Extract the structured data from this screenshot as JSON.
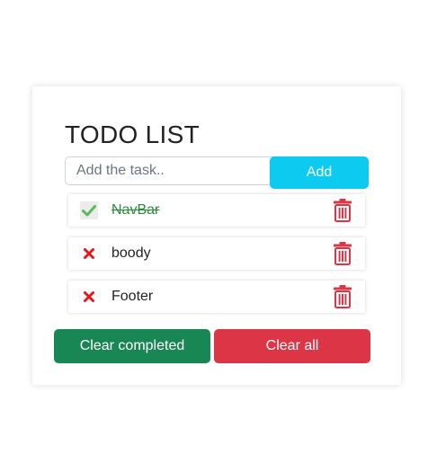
{
  "header": {
    "title": "TODO LIST"
  },
  "new_task": {
    "placeholder": "Add the task..",
    "value": "",
    "add_label": "Add"
  },
  "tasks": [
    {
      "text": "NavBar",
      "completed": true
    },
    {
      "text": "boody",
      "completed": false
    },
    {
      "text": "Footer",
      "completed": false
    }
  ],
  "actions": {
    "clear_completed_label": "Clear completed",
    "clear_all_label": "Clear all"
  },
  "colors": {
    "add_button": "#0dcaf0",
    "clear_completed_button": "#198754",
    "clear_all_button": "#dc3545",
    "check_icon": "#5cb85c",
    "cross_icon": "#e8141d",
    "trash_icon": "#dc3545",
    "completed_text": "#2a8a3c"
  },
  "icons": {
    "done": "check-icon",
    "pending": "cross-icon",
    "delete": "trash-icon"
  }
}
